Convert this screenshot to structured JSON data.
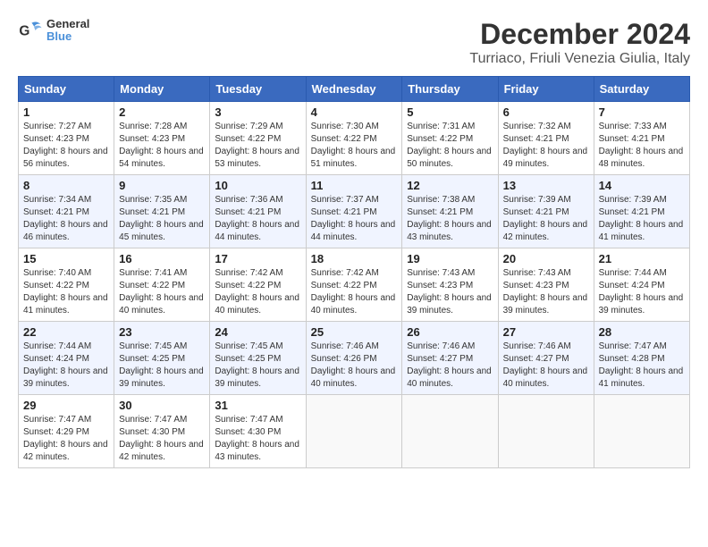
{
  "header": {
    "logo_line1": "General",
    "logo_line2": "Blue",
    "month": "December 2024",
    "location": "Turriaco, Friuli Venezia Giulia, Italy"
  },
  "weekdays": [
    "Sunday",
    "Monday",
    "Tuesday",
    "Wednesday",
    "Thursday",
    "Friday",
    "Saturday"
  ],
  "weeks": [
    [
      {
        "day": "1",
        "sunrise": "7:27 AM",
        "sunset": "4:23 PM",
        "daylight": "8 hours and 56 minutes."
      },
      {
        "day": "2",
        "sunrise": "7:28 AM",
        "sunset": "4:23 PM",
        "daylight": "8 hours and 54 minutes."
      },
      {
        "day": "3",
        "sunrise": "7:29 AM",
        "sunset": "4:22 PM",
        "daylight": "8 hours and 53 minutes."
      },
      {
        "day": "4",
        "sunrise": "7:30 AM",
        "sunset": "4:22 PM",
        "daylight": "8 hours and 51 minutes."
      },
      {
        "day": "5",
        "sunrise": "7:31 AM",
        "sunset": "4:22 PM",
        "daylight": "8 hours and 50 minutes."
      },
      {
        "day": "6",
        "sunrise": "7:32 AM",
        "sunset": "4:21 PM",
        "daylight": "8 hours and 49 minutes."
      },
      {
        "day": "7",
        "sunrise": "7:33 AM",
        "sunset": "4:21 PM",
        "daylight": "8 hours and 48 minutes."
      }
    ],
    [
      {
        "day": "8",
        "sunrise": "7:34 AM",
        "sunset": "4:21 PM",
        "daylight": "8 hours and 46 minutes."
      },
      {
        "day": "9",
        "sunrise": "7:35 AM",
        "sunset": "4:21 PM",
        "daylight": "8 hours and 45 minutes."
      },
      {
        "day": "10",
        "sunrise": "7:36 AM",
        "sunset": "4:21 PM",
        "daylight": "8 hours and 44 minutes."
      },
      {
        "day": "11",
        "sunrise": "7:37 AM",
        "sunset": "4:21 PM",
        "daylight": "8 hours and 44 minutes."
      },
      {
        "day": "12",
        "sunrise": "7:38 AM",
        "sunset": "4:21 PM",
        "daylight": "8 hours and 43 minutes."
      },
      {
        "day": "13",
        "sunrise": "7:39 AM",
        "sunset": "4:21 PM",
        "daylight": "8 hours and 42 minutes."
      },
      {
        "day": "14",
        "sunrise": "7:39 AM",
        "sunset": "4:21 PM",
        "daylight": "8 hours and 41 minutes."
      }
    ],
    [
      {
        "day": "15",
        "sunrise": "7:40 AM",
        "sunset": "4:22 PM",
        "daylight": "8 hours and 41 minutes."
      },
      {
        "day": "16",
        "sunrise": "7:41 AM",
        "sunset": "4:22 PM",
        "daylight": "8 hours and 40 minutes."
      },
      {
        "day": "17",
        "sunrise": "7:42 AM",
        "sunset": "4:22 PM",
        "daylight": "8 hours and 40 minutes."
      },
      {
        "day": "18",
        "sunrise": "7:42 AM",
        "sunset": "4:22 PM",
        "daylight": "8 hours and 40 minutes."
      },
      {
        "day": "19",
        "sunrise": "7:43 AM",
        "sunset": "4:23 PM",
        "daylight": "8 hours and 39 minutes."
      },
      {
        "day": "20",
        "sunrise": "7:43 AM",
        "sunset": "4:23 PM",
        "daylight": "8 hours and 39 minutes."
      },
      {
        "day": "21",
        "sunrise": "7:44 AM",
        "sunset": "4:24 PM",
        "daylight": "8 hours and 39 minutes."
      }
    ],
    [
      {
        "day": "22",
        "sunrise": "7:44 AM",
        "sunset": "4:24 PM",
        "daylight": "8 hours and 39 minutes."
      },
      {
        "day": "23",
        "sunrise": "7:45 AM",
        "sunset": "4:25 PM",
        "daylight": "8 hours and 39 minutes."
      },
      {
        "day": "24",
        "sunrise": "7:45 AM",
        "sunset": "4:25 PM",
        "daylight": "8 hours and 39 minutes."
      },
      {
        "day": "25",
        "sunrise": "7:46 AM",
        "sunset": "4:26 PM",
        "daylight": "8 hours and 40 minutes."
      },
      {
        "day": "26",
        "sunrise": "7:46 AM",
        "sunset": "4:27 PM",
        "daylight": "8 hours and 40 minutes."
      },
      {
        "day": "27",
        "sunrise": "7:46 AM",
        "sunset": "4:27 PM",
        "daylight": "8 hours and 40 minutes."
      },
      {
        "day": "28",
        "sunrise": "7:47 AM",
        "sunset": "4:28 PM",
        "daylight": "8 hours and 41 minutes."
      }
    ],
    [
      {
        "day": "29",
        "sunrise": "7:47 AM",
        "sunset": "4:29 PM",
        "daylight": "8 hours and 42 minutes."
      },
      {
        "day": "30",
        "sunrise": "7:47 AM",
        "sunset": "4:30 PM",
        "daylight": "8 hours and 42 minutes."
      },
      {
        "day": "31",
        "sunrise": "7:47 AM",
        "sunset": "4:30 PM",
        "daylight": "8 hours and 43 minutes."
      },
      null,
      null,
      null,
      null
    ]
  ]
}
